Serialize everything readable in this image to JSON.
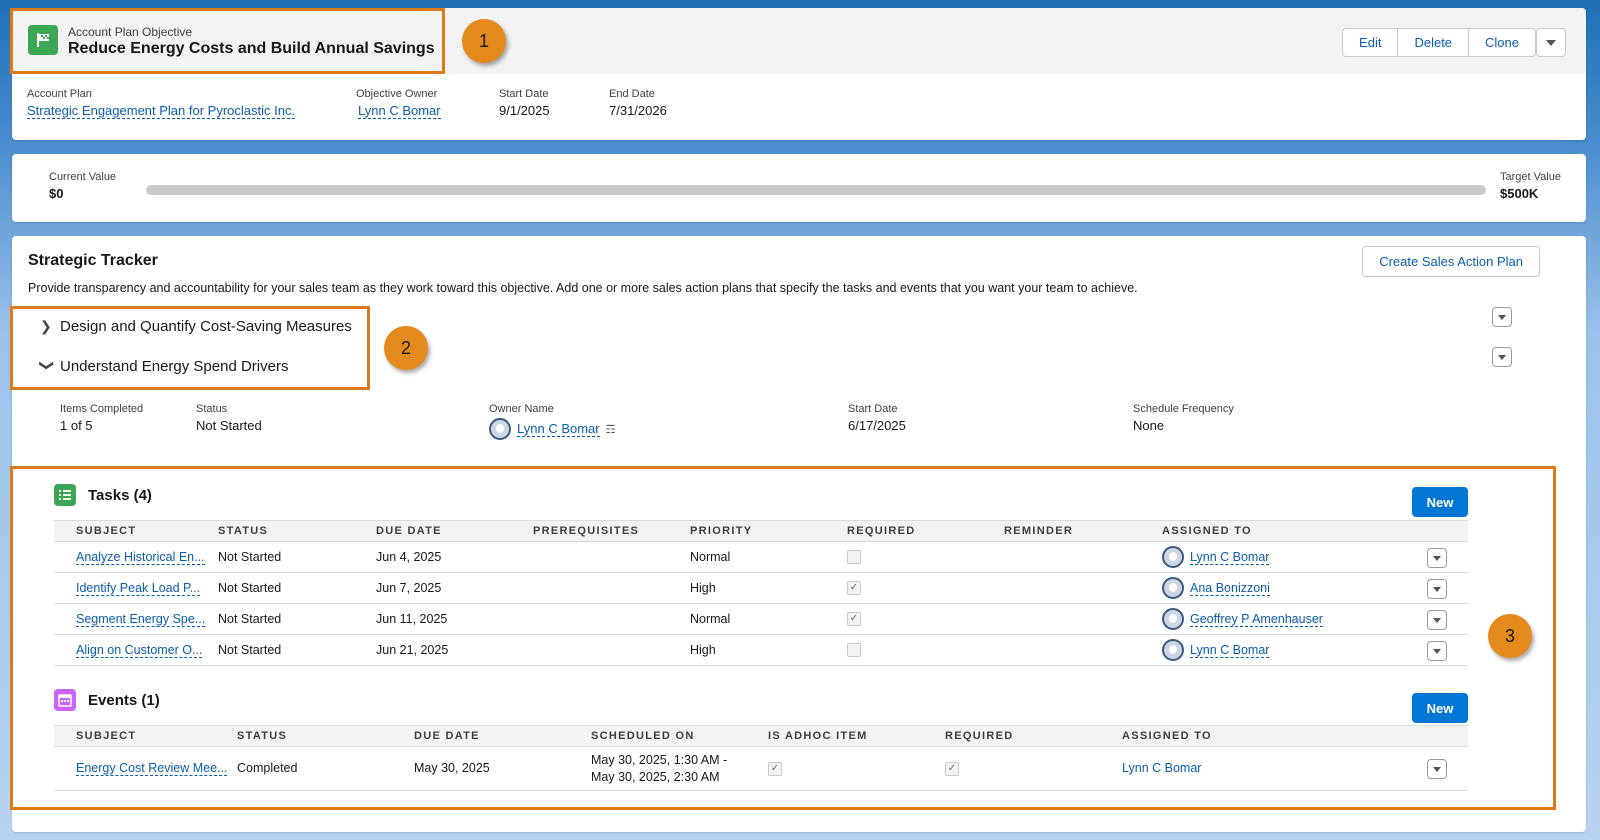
{
  "header": {
    "object_type": "Account Plan Objective",
    "title": "Reduce Energy Costs and Build Annual Savings",
    "buttons": {
      "edit": "Edit",
      "delete": "Delete",
      "clone": "Clone"
    },
    "fields": [
      {
        "label": "Account Plan",
        "value": "Strategic Engagement Plan for Pyroclastic Inc."
      },
      {
        "label": "Objective Owner",
        "value": "Lynn C Bomar"
      },
      {
        "label": "Start Date",
        "value": "9/1/2025"
      },
      {
        "label": "End Date",
        "value": "7/31/2026"
      }
    ]
  },
  "progress": {
    "current_label": "Current Value",
    "current_value": "$0",
    "target_label": "Target Value",
    "target_value": "$500K",
    "fraction": 0
  },
  "tracker": {
    "title": "Strategic Tracker",
    "description": "Provide transparency and accountability for your sales team as they work toward this objective. Add one or more sales action plans that specify the tasks and events that you want your team to achieve.",
    "create_button": "Create Sales Action Plan",
    "plans": [
      {
        "name": "Design and Quantify Cost-Saving Measures",
        "expanded": false
      },
      {
        "name": "Understand Energy Spend Drivers",
        "expanded": true
      }
    ],
    "plan_fields": [
      {
        "label": "Items Completed",
        "value": "1 of 5"
      },
      {
        "label": "Status",
        "value": "Not Started"
      },
      {
        "label": "Owner Name",
        "value": "Lynn C Bomar"
      },
      {
        "label": "Start Date",
        "value": "6/17/2025"
      },
      {
        "label": "Schedule Frequency",
        "value": "None"
      }
    ]
  },
  "tasks": {
    "title": "Tasks (4)",
    "new_button": "New",
    "columns": [
      "SUBJECT",
      "STATUS",
      "DUE DATE",
      "PREREQUISITES",
      "PRIORITY",
      "REQUIRED",
      "REMINDER",
      "ASSIGNED TO"
    ],
    "rows": [
      {
        "subject": "Analyze Historical En...",
        "status": "Not Started",
        "due": "Jun 4, 2025",
        "priority": "Normal",
        "required": false,
        "assigned": "Lynn C Bomar"
      },
      {
        "subject": "Identify Peak Load P...",
        "status": "Not Started",
        "due": "Jun 7, 2025",
        "priority": "High",
        "required": true,
        "assigned": "Ana Bonizzoni"
      },
      {
        "subject": "Segment Energy Spe...",
        "status": "Not Started",
        "due": "Jun 11, 2025",
        "priority": "Normal",
        "required": true,
        "assigned": "Geoffrey P Amenhauser"
      },
      {
        "subject": "Align on Customer O...",
        "status": "Not Started",
        "due": "Jun 21, 2025",
        "priority": "High",
        "required": false,
        "assigned": "Lynn C Bomar"
      }
    ]
  },
  "events": {
    "title": "Events (1)",
    "new_button": "New",
    "columns": [
      "SUBJECT",
      "STATUS",
      "DUE DATE",
      "SCHEDULED ON",
      "IS ADHOC ITEM",
      "REQUIRED",
      "ASSIGNED TO"
    ],
    "rows": [
      {
        "subject": "Energy Cost Review Mee...",
        "status": "Completed",
        "due": "May 30, 2025",
        "scheduled_line1": "May 30, 2025, 1:30 AM -",
        "scheduled_line2": "May 30, 2025, 2:30 AM",
        "adhoc": true,
        "required": true,
        "assigned": "Lynn C Bomar"
      }
    ]
  },
  "callouts": [
    "1",
    "2",
    "3"
  ],
  "colors": {
    "brand_blue": "#0176d3",
    "link": "#0b5cab",
    "highlight": "#dd7a1a",
    "objective_icon": "#3ba755",
    "task_icon": "#3ba755",
    "event_icon": "#cb65ff"
  }
}
